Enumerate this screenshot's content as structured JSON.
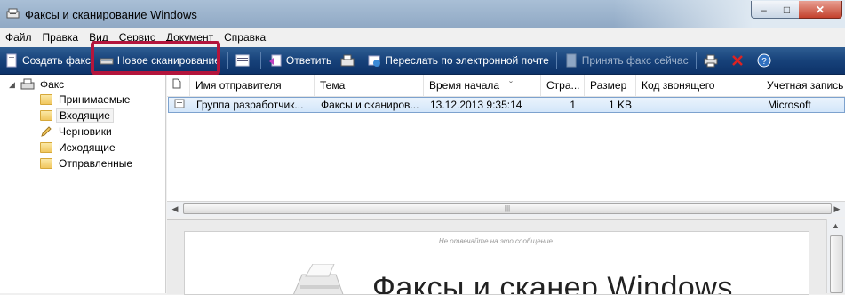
{
  "window": {
    "title": "Факсы и сканирование Windows",
    "controls": {
      "minimize": "–",
      "maximize": "□",
      "close": "✕"
    }
  },
  "menu": [
    "Файл",
    "Правка",
    "Вид",
    "Сервис",
    "Документ",
    "Справка"
  ],
  "toolbar": {
    "create_fax": "Создать факс",
    "new_scan": "Новое сканирование",
    "reply": "Ответить",
    "forward_email": "Переслать по электронной почте",
    "receive_fax_now": "Принять факс сейчас",
    "highlight_color": "#b3153c"
  },
  "tree": {
    "root": "Факс",
    "folders": [
      "Принимаемые",
      "Входящие",
      "Черновики",
      "Исходящие",
      "Отправленные"
    ],
    "selected": "Входящие"
  },
  "list": {
    "columns": [
      "Имя отправителя",
      "Тема",
      "Время начала",
      "Стра...",
      "Размер",
      "Код звонящего",
      "Учетная запись"
    ],
    "rows": [
      {
        "sender": "Группа разработчик...",
        "subject": "Факсы и сканиров...",
        "start_time": "13.12.2013 9:35:14",
        "pages": "1",
        "size": "1 KB",
        "caller_id": "",
        "account": "Microsoft"
      }
    ],
    "sort_indicator": "ˇ"
  },
  "preview": {
    "note": "Не отвечайте на это сообщение.",
    "heading": "Факсы и сканер Windows"
  }
}
